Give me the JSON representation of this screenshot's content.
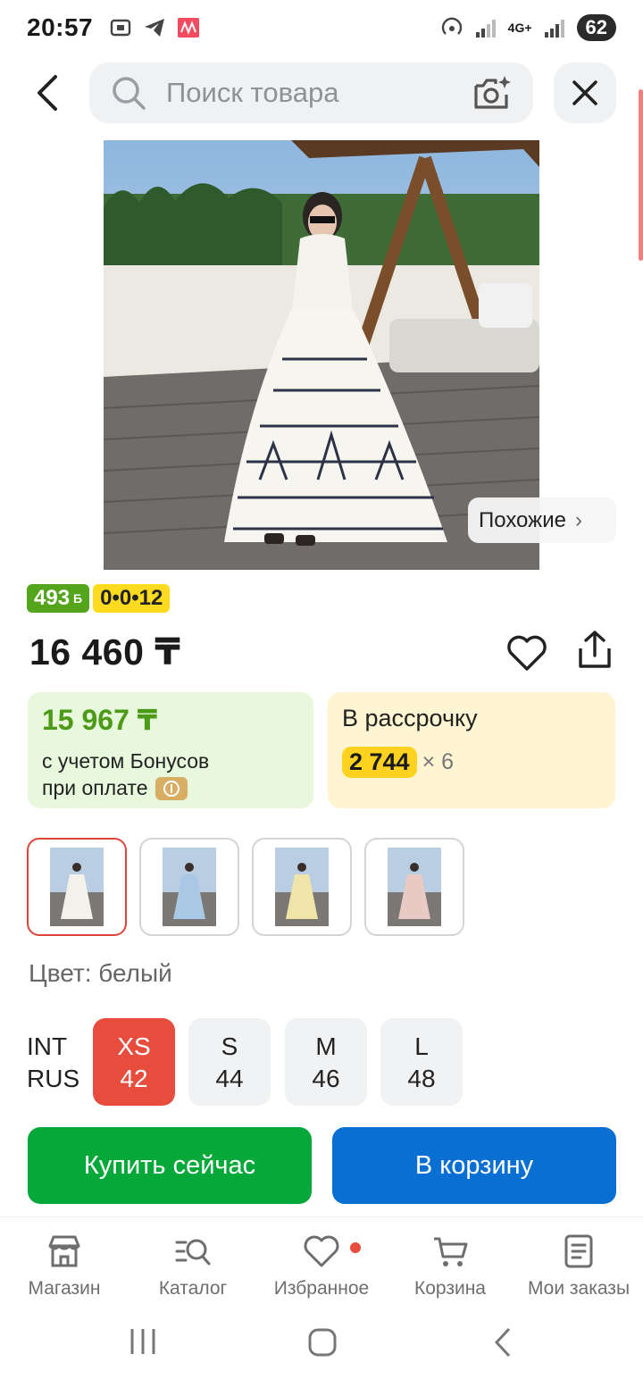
{
  "status_bar": {
    "time": "20:57",
    "network": "4G+",
    "battery": "62",
    "app_icons": [
      "screen-record-icon",
      "telegram-icon",
      "app-red-icon"
    ]
  },
  "search": {
    "placeholder": "Поиск товара"
  },
  "product": {
    "similar_label": "Похожие",
    "badge_bonus": "493",
    "badge_bonus_unit": "Б",
    "badge_installment": "0•0•12",
    "price": "16 460 ₸"
  },
  "bonus_card": {
    "price": "15 967 ₸",
    "line1": "с учетом Бонусов",
    "line2": "при оплате"
  },
  "installment_card": {
    "title": "В рассрочку",
    "amount": "2 744",
    "multiplier": "× 6"
  },
  "variants": {
    "color_label": "Цвет: белый",
    "thumbs": [
      {
        "name": "белый",
        "color": "#f3f1ea",
        "selected": true
      },
      {
        "name": "голубой",
        "color": "#a9c8e6",
        "selected": false
      },
      {
        "name": "желтый",
        "color": "#efe5a8",
        "selected": false
      },
      {
        "name": "розовый",
        "color": "#e8c9c4",
        "selected": false
      }
    ]
  },
  "sizes": {
    "label_int": "INT",
    "label_rus": "RUS",
    "items": [
      {
        "int": "XS",
        "rus": "42",
        "selected": true
      },
      {
        "int": "S",
        "rus": "44",
        "selected": false
      },
      {
        "int": "M",
        "rus": "46",
        "selected": false
      },
      {
        "int": "L",
        "rus": "48",
        "selected": false
      }
    ]
  },
  "actions": {
    "buy_now": "Купить сейчас",
    "add_to_cart": "В корзину"
  },
  "bottom_nav": {
    "items": [
      {
        "label": "Магазин",
        "icon": "store-icon"
      },
      {
        "label": "Каталог",
        "icon": "catalog-search-icon"
      },
      {
        "label": "Избранное",
        "icon": "heart-icon"
      },
      {
        "label": "Корзина",
        "icon": "cart-icon"
      },
      {
        "label": "Мои заказы",
        "icon": "orders-icon"
      }
    ]
  },
  "colors": {
    "accent_red": "#e74c3c",
    "buy_green": "#07a83a",
    "cart_blue": "#0a6fd3",
    "bonus_green": "#55a51c",
    "installment_yellow": "#ffd21f"
  }
}
